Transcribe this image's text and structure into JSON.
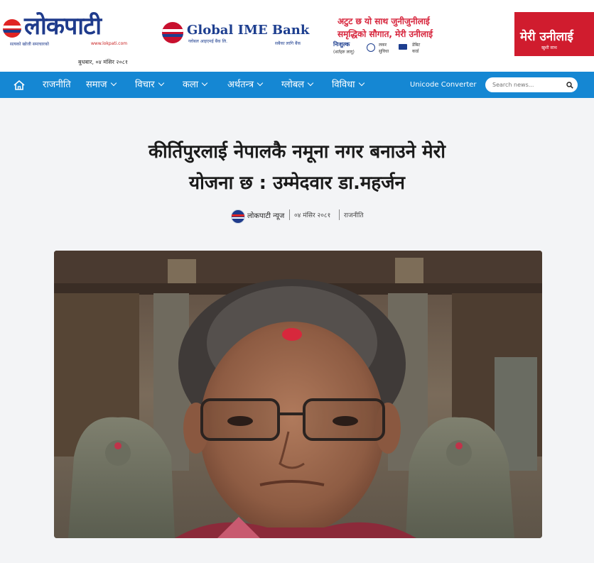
{
  "header": {
    "logo_text": "लोकपाटी",
    "logo_tagline": "सत्यको खोजी समाचारको",
    "logo_url": "www.lokpati.com",
    "date": "बुधबार, ०४ मंसिर २०८१"
  },
  "ad": {
    "bank_name": "Global IME Bank",
    "bank_subtitle": "ग्लोबल आइएमई बैंक लि.",
    "bank_slogan": "सबैका लागि बैंक",
    "headline_line1": "अटुट छ यो साथ जुनीजुनीलाई",
    "headline_line2": "समृद्धिको सौगात, मेरी उनीलाई",
    "feature1": "निःशुल्क",
    "feature1_sub": "(शर्तहरु लागू)",
    "feature2_line1": "लकर",
    "feature2_line2": "सुविधा",
    "feature3_line1": "डेबिट",
    "feature3_line2": "कार्ड",
    "campaign_title": "मेरी उनीलाई",
    "campaign_sub": "खुशी साथ"
  },
  "nav": {
    "items": [
      "राजनीति",
      "समाज",
      "विचार",
      "कला",
      "अर्थतन्त्र",
      "ग्लोबल",
      "विविधा"
    ],
    "unicode_converter": "Unicode Converter",
    "search_placeholder": "Search news..."
  },
  "article": {
    "title_line1": "कीर्तिपुरलाई नेपालकै नमूना नगर बनाउने मेरो",
    "title_line2": "योजना छ : उम्मेदवार डा.महर्जन",
    "author": "लोकपाटी न्यूज",
    "date": "०४ मंसिर २०८१",
    "category": "राजनीति"
  },
  "colors": {
    "nav_blue": "#1587d3",
    "brand_blue": "#1f3b8c",
    "brand_red": "#e02424"
  }
}
